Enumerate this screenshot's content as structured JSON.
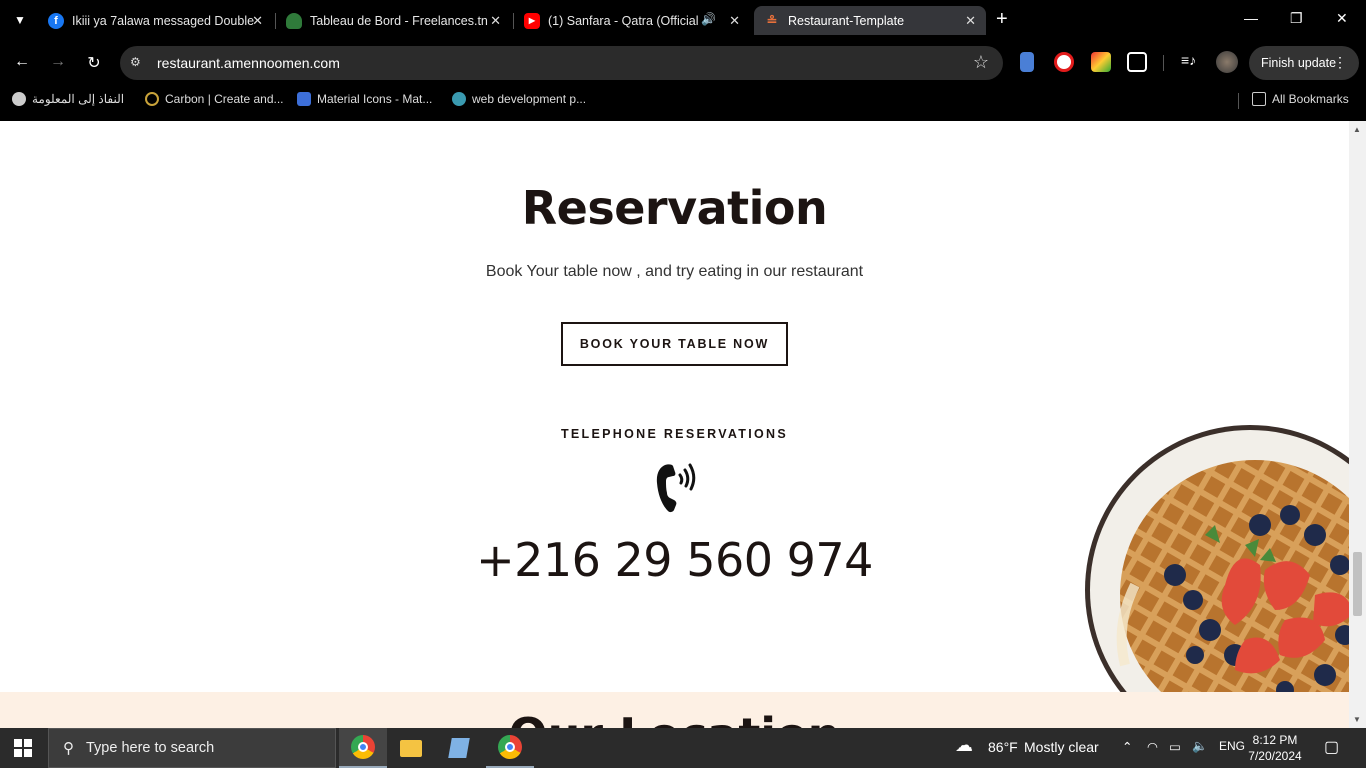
{
  "browser": {
    "tabs": [
      {
        "title": "Ikiii ya 7alawa messaged Double",
        "icon": "facebook-icon"
      },
      {
        "title": "Tableau de Bord - Freelances.tn",
        "icon": "freelances-icon"
      },
      {
        "title": "(1) Sanfara - Qatra (Official",
        "icon": "youtube-icon"
      },
      {
        "title": "Restaurant-Template",
        "icon": "restaurant-icon"
      }
    ],
    "url": "restaurant.amennoomen.com",
    "finish_update": "Finish update",
    "bookmarks": [
      "النفاذ إلى المعلومة",
      "Carbon | Create and...",
      "Material Icons - Mat...",
      "web development p..."
    ],
    "all_bookmarks": "All Bookmarks"
  },
  "page": {
    "reservation_title": "Reservation",
    "reservation_subtitle": "Book Your table now , and try eating in our restaurant",
    "book_button": "BOOK YOUR TABLE NOW",
    "telephone_label": "TELEPHONE RESERVATIONS",
    "phone_number": "+216 29 560 974",
    "next_section_title": "Our Location"
  },
  "taskbar": {
    "search_placeholder": "Type here to search",
    "weather_temp": "86°F",
    "weather_desc": "Mostly clear",
    "language": "ENG",
    "time": "8:12 PM",
    "date": "7/20/2024"
  },
  "colors": {
    "page_text": "#1c1412",
    "bottom_band": "#fdf0e4",
    "chrome_bg": "#000000",
    "active_tab": "#35363a"
  }
}
